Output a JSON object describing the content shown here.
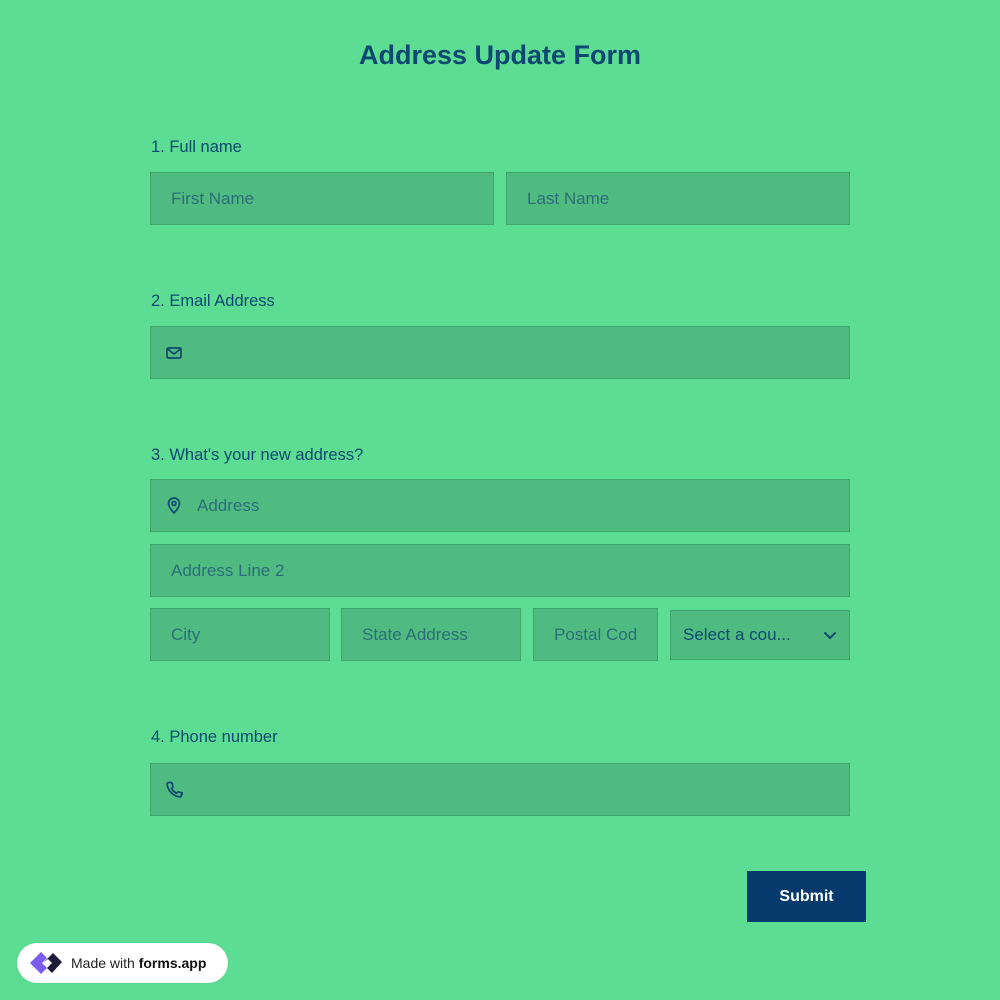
{
  "form": {
    "title": "Address Update Form",
    "q1": {
      "label": "1.  Full name",
      "first_placeholder": "First Name",
      "last_placeholder": "Last Name"
    },
    "q2": {
      "label": "2. Email Address",
      "icon": "mail-icon"
    },
    "q3": {
      "label": "3. What's your new address?",
      "address_placeholder": "Address",
      "address2_placeholder": "Address Line 2",
      "city_placeholder": "City",
      "state_placeholder": "State Address",
      "postal_placeholder": "Postal Cod",
      "country_selected": "Select a cou..."
    },
    "q4": {
      "label": "4. Phone number",
      "icon": "phone-icon"
    },
    "submit_label": "Submit"
  },
  "badge": {
    "prefix": "Made with ",
    "brand": "forms.app"
  },
  "colors": {
    "background": "#5cdd93",
    "field": "#50bb80",
    "text": "#0c4870",
    "submit": "#073a6c",
    "logo": "#7b5cf0"
  }
}
